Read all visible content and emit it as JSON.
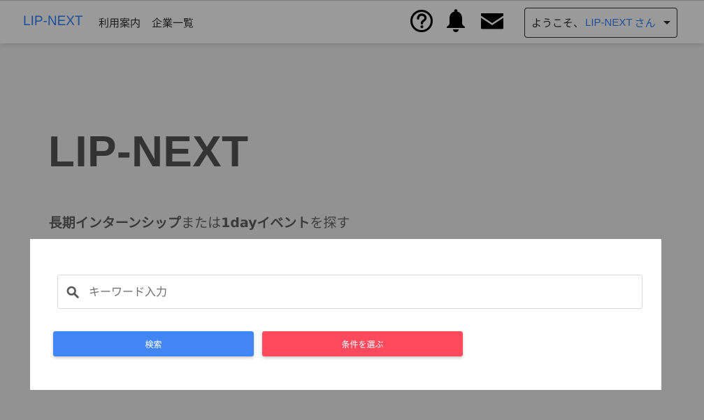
{
  "navbar": {
    "brand": "LIP-NEXT",
    "links": [
      "利用案内",
      "企業一覧"
    ],
    "icons": [
      "help-circle-icon",
      "bell-icon",
      "mail-icon"
    ],
    "user": {
      "greeting": "ようこそ、",
      "name": "LIP-NEXT",
      "honorific": "さん"
    }
  },
  "hero": {
    "title": "LIP-NEXT",
    "subtitle": {
      "part1_bold": "長期インターンシップ",
      "part2": "または",
      "part3_bold": "1dayイベント",
      "part4": "を探す"
    }
  },
  "search": {
    "placeholder": "キーワード入力",
    "value": "",
    "search_button": "検索",
    "filter_button": "条件を選ぶ"
  },
  "colors": {
    "brand": "#1f4e98",
    "search_button": "#4285f4",
    "filter_button": "#ff4a5e",
    "overlay": "#929292"
  }
}
